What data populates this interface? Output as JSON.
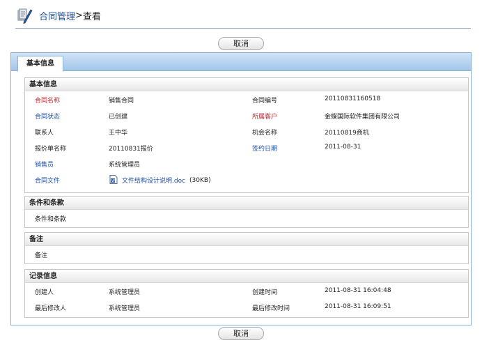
{
  "header": {
    "breadcrumb_link": "合同管理",
    "breadcrumb_sep": ">",
    "breadcrumb_current": "查看"
  },
  "buttons": {
    "cancel_top": "取消",
    "cancel_bottom": "取消"
  },
  "tabs": {
    "active": "基本信息"
  },
  "basic": {
    "title": "基本信息",
    "rows": [
      {
        "l1": "合同名称",
        "v1": "销售合同",
        "l2": "合同编号",
        "v2": "20110831160518"
      },
      {
        "l1": "合同状态",
        "v1": "已创建",
        "l2": "所属客户",
        "v2": "金蝶国际软件集团有限公司"
      },
      {
        "l1": "联系人",
        "v1": "王中华",
        "l2": "机会名称",
        "v2": "20110819商机"
      },
      {
        "l1": "报价单名称",
        "v1": "20110831报价",
        "l2": "签约日期",
        "v2": "2011-08-31"
      },
      {
        "l1": "销售员",
        "v1": "系统管理员"
      }
    ],
    "file_label": "合同文件",
    "file_name": "文件结构设计说明.doc",
    "file_size": "(30KB)"
  },
  "terms": {
    "title": "条件和条款",
    "value": "条件和条款"
  },
  "remarks": {
    "title": "备注",
    "value": "备注"
  },
  "record": {
    "title": "记录信息",
    "rows": [
      {
        "l1": "创建人",
        "v1": "系统管理员",
        "l2": "创建时间",
        "v2": "2011-08-31 16:04:48"
      },
      {
        "l1": "最后修改人",
        "v1": "系统管理员",
        "l2": "最后修改时间",
        "v2": "2011-08-31 16:09:51"
      }
    ]
  },
  "colors": {
    "label_red": "#c0262d",
    "label_blue": "#1f4fa3",
    "tab_bar": "#a4c6ea"
  },
  "icons": {
    "header": "contract-pen-icon",
    "file": "word-doc-icon"
  }
}
